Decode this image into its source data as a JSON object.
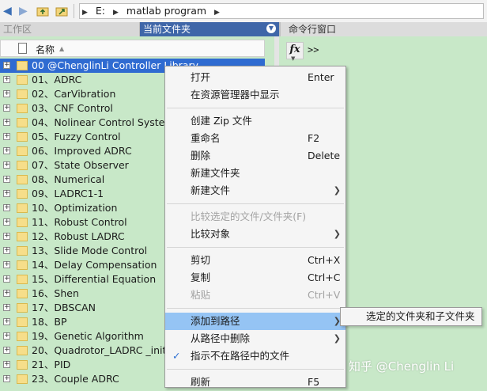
{
  "toolbar": {
    "path": [
      "E:",
      "matlab program"
    ],
    "icons": [
      "back-arrow-icon",
      "forward-arrow-icon",
      "folder-up-icon",
      "browse-folder-icon"
    ]
  },
  "panels": {
    "workspace_title": "工作区",
    "current_folder_title": "当前文件夹",
    "command_window_title": "命令行窗口"
  },
  "file_browser": {
    "column_name": "名称",
    "items": [
      "00 @ChenglinLi Controller Library",
      "01、ADRC",
      "02、CarVibration",
      "03、CNF Control",
      "04、Nolinear Control System",
      "05、Fuzzy Control",
      "06、Improved ADRC",
      "07、State Observer",
      "08、Numerical",
      "09、LADRC1-1",
      "10、Optimization",
      "11、Robust Control",
      "12、Robust LADRC",
      "13、Slide Mode Control",
      "14、Delay Compensation",
      "15、Differential Equation",
      "16、Shen",
      "17、DBSCAN",
      "18、BP",
      "19、Genetic Algorithm",
      "20、Quadrotor_LADRC _initial",
      "21、PID",
      "23、Couple ADRC"
    ]
  },
  "command_window": {
    "fx": "fx",
    "prompt": ">>"
  },
  "context_menu": {
    "open": {
      "label": "打开",
      "shortcut": "Enter"
    },
    "show_in_explorer": {
      "label": "在资源管理器中显示"
    },
    "create_zip": {
      "label": "创建 Zip 文件"
    },
    "rename": {
      "label": "重命名",
      "shortcut": "F2"
    },
    "delete": {
      "label": "删除",
      "shortcut": "Delete"
    },
    "new_folder": {
      "label": "新建文件夹"
    },
    "new_file": {
      "label": "新建文件"
    },
    "compare_selected": {
      "label": "比较选定的文件/文件夹(F)"
    },
    "compare_with": {
      "label": "比较对象"
    },
    "cut": {
      "label": "剪切",
      "shortcut": "Ctrl+X"
    },
    "copy": {
      "label": "复制",
      "shortcut": "Ctrl+C"
    },
    "paste": {
      "label": "粘贴",
      "shortcut": "Ctrl+V"
    },
    "add_to_path": {
      "label": "添加到路径"
    },
    "remove_from_path": {
      "label": "从路径中删除"
    },
    "indicate_not_on_path": {
      "label": "指示不在路径中的文件"
    },
    "refresh": {
      "label": "刷新",
      "shortcut": "F5"
    }
  },
  "submenu": {
    "selected_folders_and_subfolders": "选定的文件夹和子文件夹"
  },
  "watermark": "知乎 @Chenglin Li"
}
